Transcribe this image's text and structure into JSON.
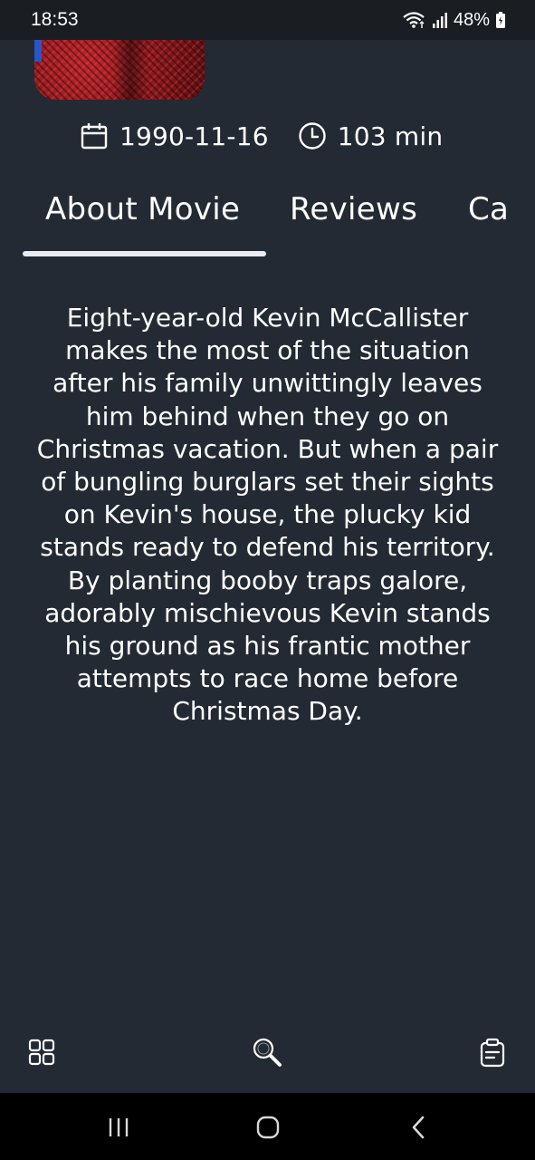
{
  "status_bar": {
    "time": "18:53",
    "battery": "48%",
    "icons": [
      "wifi-icon",
      "signal-icon",
      "battery-icon"
    ]
  },
  "movie": {
    "release_date": "1990-11-16",
    "runtime": "103 min",
    "overview": "Eight-year-old Kevin McCallister makes the most of the situation after his family unwittingly leaves him behind when they go on Christmas vacation. But when a pair of bungling burglars set their sights on Kevin's house, the plucky kid stands ready to defend his territory. By planting booby traps galore, adorably mischievous Kevin stands his ground as his frantic mother attempts to race home before Christmas Day."
  },
  "meta_icons": [
    "calendar-icon",
    "clock-icon"
  ],
  "tabs": [
    {
      "label": "About Movie",
      "selected": true
    },
    {
      "label": "Reviews",
      "selected": false
    },
    {
      "label": "Ca",
      "selected": false
    }
  ],
  "bottom_nav": {
    "items": [
      "grid-icon",
      "search-icon",
      "watchlist-icon"
    ]
  },
  "system_nav": {
    "items": [
      "recents-icon",
      "home-icon",
      "back-icon"
    ]
  },
  "colors": {
    "background": "#242a33",
    "status_bar": "#1a1d22",
    "system_nav": "#000000",
    "text": "#ffffff",
    "tab_indicator": "#e9ebef"
  }
}
